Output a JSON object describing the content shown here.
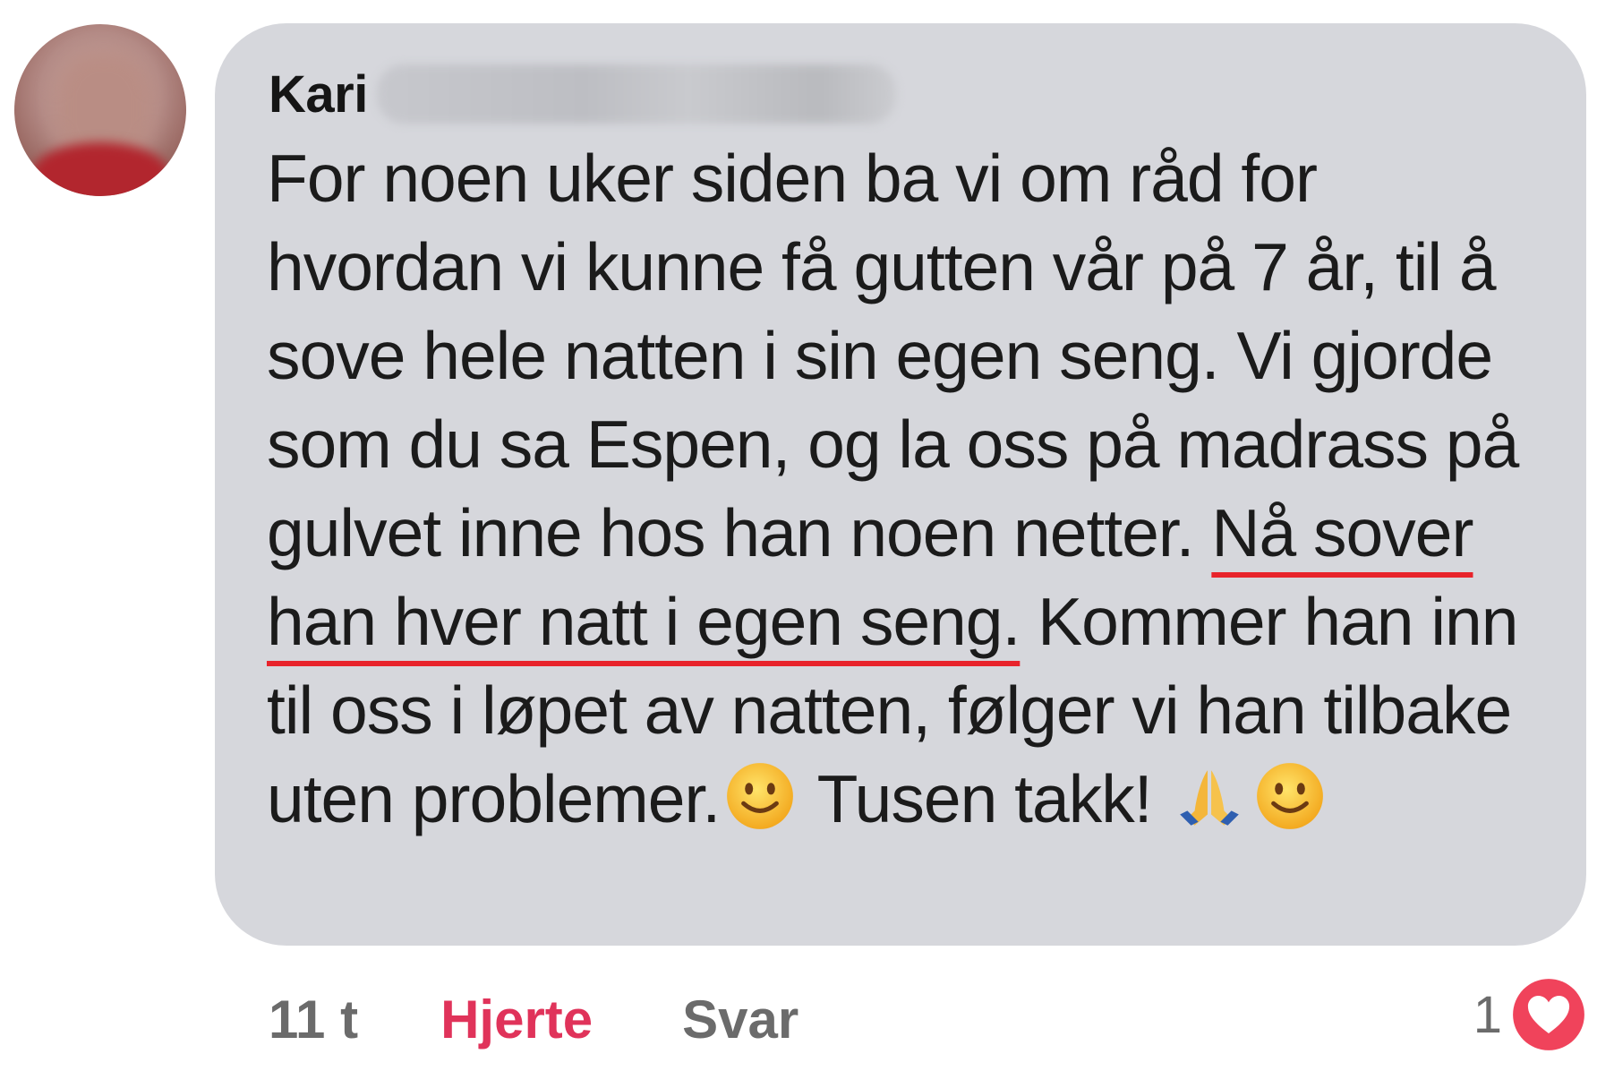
{
  "comment": {
    "author": "Kari",
    "text_parts": [
      "For noen uker siden ba vi om råd for hvordan vi kunne få gutten vår på 7 år, til å sove hele natten i sin egen seng.  Vi gjorde som du sa Espen, og la oss på madrass på gulvet inne hos han noen netter. ",
      "Nå sover han hver natt i egen seng.",
      " Kommer han inn til oss i løpet av natten, følger vi han tilbake uten problemer.",
      "  Tusen takk! "
    ],
    "emojis": [
      "slightly-smiling-face",
      "folded-hands",
      "slightly-smiling-face"
    ]
  },
  "meta": {
    "time": "11 t",
    "heart_label": "Hjerte",
    "reply_label": "Svar",
    "reaction_count": "1"
  },
  "colors": {
    "bubble": "#d6d7dc",
    "underline": "#e8232b",
    "heart_action": "#e0335a",
    "heart_badge": "#f0435b"
  }
}
